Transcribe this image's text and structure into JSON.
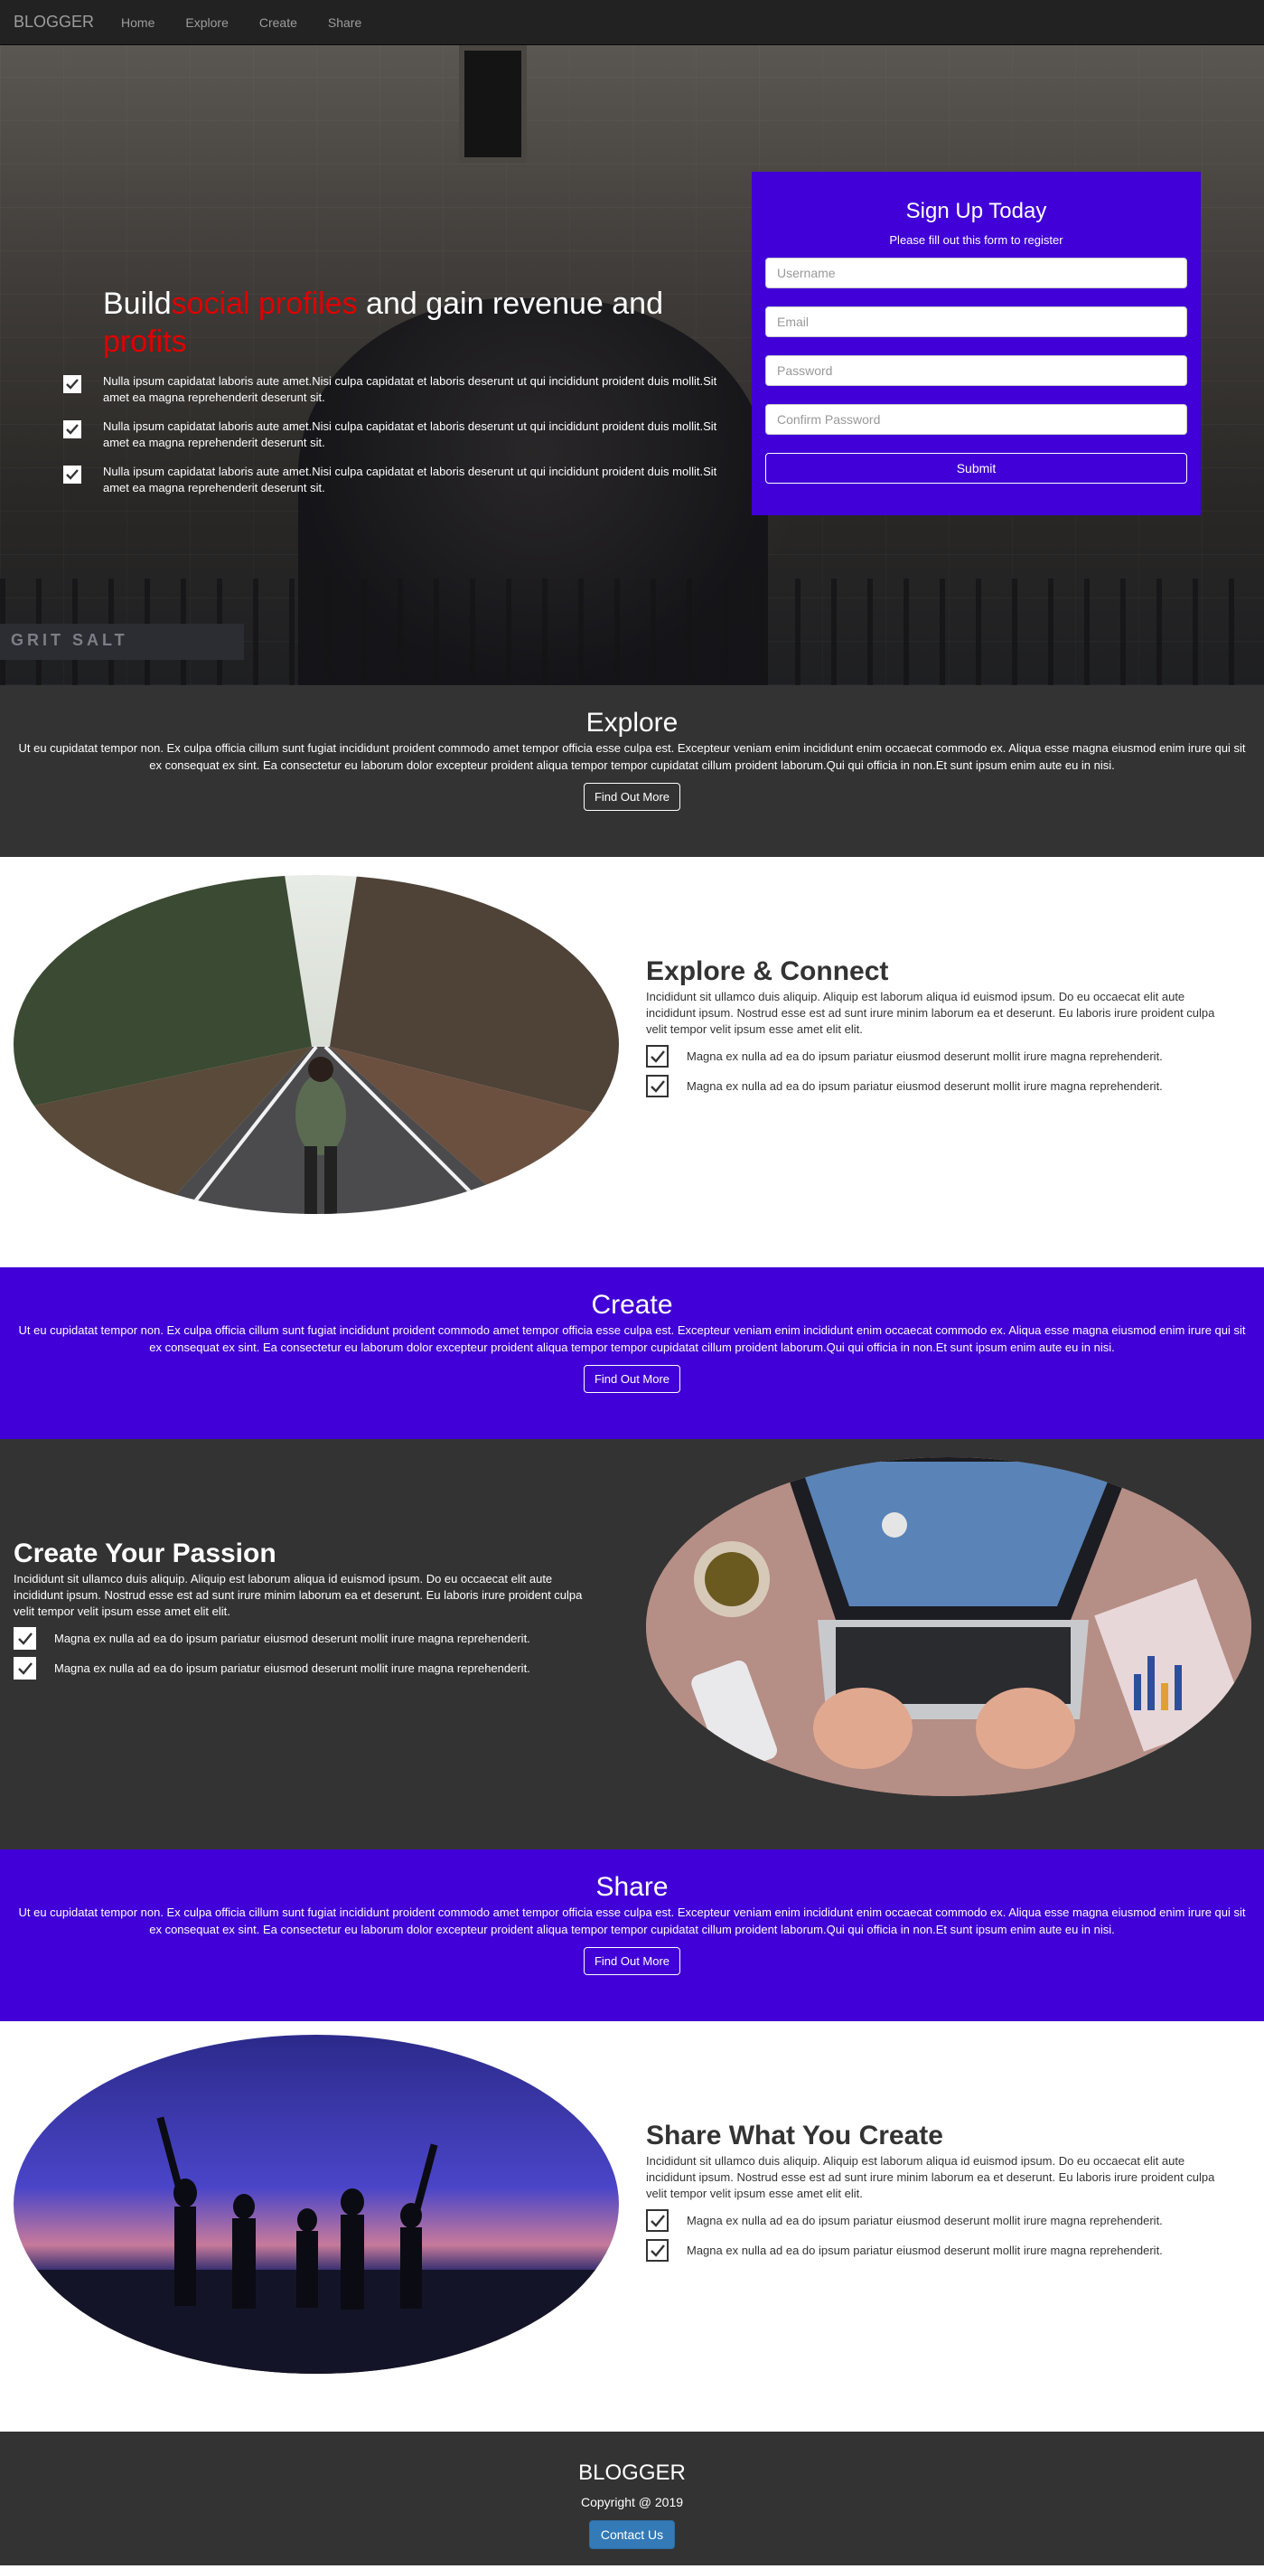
{
  "nav": {
    "brand": "BLOGGER",
    "items": [
      "Home",
      "Explore",
      "Create",
      "Share"
    ]
  },
  "hero": {
    "title_pre": "Build",
    "title_red1": "social profiles",
    "title_mid": " and gain revenue and ",
    "title_red2": "profits",
    "features": [
      "Nulla ipsum capidatat laboris aute amet.Nisi culpa capidatat et laboris deserunt ut qui incididunt proident duis mollit.Sit amet ea magna reprehenderit deserunt sit.",
      "Nulla ipsum capidatat laboris aute amet.Nisi culpa capidatat et laboris deserunt ut qui incididunt proident duis mollit.Sit amet ea magna reprehenderit deserunt sit.",
      "Nulla ipsum capidatat laboris aute amet.Nisi culpa capidatat et laboris deserunt ut qui incididunt proident duis mollit.Sit amet ea magna reprehenderit deserunt sit."
    ],
    "sign_text": "GRIT SALT"
  },
  "signup": {
    "title": "Sign Up Today",
    "subtitle": "Please fill out this form to register",
    "username_placeholder": "Username",
    "email_placeholder": "Email",
    "password_placeholder": "Password",
    "confirm_placeholder": "Confirm Password",
    "submit_label": "Submit"
  },
  "explore_band": {
    "title": "Explore",
    "text": "Ut eu cupidatat tempor non. Ex culpa officia cillum sunt fugiat incididunt proident commodo amet tempor officia esse culpa est. Excepteur veniam enim incididunt enim occaecat commodo ex. Aliqua esse magna eiusmod enim irure qui sit ex consequat ex sint. Ea consectetur eu laborum dolor excepteur proident aliqua tempor tempor cupidatat cillum proident laborum.Qui qui officia in non.Et sunt ipsum enim aute eu in nisi.",
    "button": "Find Out More"
  },
  "explore_feature": {
    "title": "Explore & Connect",
    "desc": "Incididunt sit ullamco duis aliquip. Aliquip est laborum aliqua id euismod ipsum. Do eu occaecat elit aute incididunt ipsum. Nostrud esse est ad sunt irure minim laborum ea et deserunt. Eu laboris irure proident culpa velit tempor velit ipsum esse amet elit elit.",
    "items": [
      "Magna ex nulla ad ea do ipsum pariatur eiusmod deserunt mollit irure magna reprehenderit.",
      "Magna ex nulla ad ea do ipsum pariatur eiusmod deserunt mollit irure magna reprehenderit."
    ]
  },
  "create_band": {
    "title": "Create",
    "text": "Ut eu cupidatat tempor non. Ex culpa officia cillum sunt fugiat incididunt proident commodo amet tempor officia esse culpa est. Excepteur veniam enim incididunt enim occaecat commodo ex. Aliqua esse magna eiusmod enim irure qui sit ex consequat ex sint. Ea consectetur eu laborum dolor excepteur proident aliqua tempor tempor cupidatat cillum proident laborum.Qui qui officia in non.Et sunt ipsum enim aute eu in nisi.",
    "button": "Find Out More"
  },
  "create_feature": {
    "title": "Create Your Passion",
    "desc": "Incididunt sit ullamco duis aliquip. Aliquip est laborum aliqua id euismod ipsum. Do eu occaecat elit aute incididunt ipsum. Nostrud esse est ad sunt irure minim laborum ea et deserunt. Eu laboris irure proident culpa velit tempor velit ipsum esse amet elit elit.",
    "items": [
      "Magna ex nulla ad ea do ipsum pariatur eiusmod deserunt mollit irure magna reprehenderit.",
      "Magna ex nulla ad ea do ipsum pariatur eiusmod deserunt mollit irure magna reprehenderit."
    ]
  },
  "share_band": {
    "title": "Share",
    "text": "Ut eu cupidatat tempor non. Ex culpa officia cillum sunt fugiat incididunt proident commodo amet tempor officia esse culpa est. Excepteur veniam enim incididunt enim occaecat commodo ex. Aliqua esse magna eiusmod enim irure qui sit ex consequat ex sint. Ea consectetur eu laborum dolor excepteur proident aliqua tempor tempor cupidatat cillum proident laborum.Qui qui officia in non.Et sunt ipsum enim aute eu in nisi.",
    "button": "Find Out More"
  },
  "share_feature": {
    "title": "Share What You Create",
    "desc": "Incididunt sit ullamco duis aliquip. Aliquip est laborum aliqua id euismod ipsum. Do eu occaecat elit aute incididunt ipsum. Nostrud esse est ad sunt irure minim laborum ea et deserunt. Eu laboris irure proident culpa velit tempor velit ipsum esse amet elit elit.",
    "items": [
      "Magna ex nulla ad ea do ipsum pariatur eiusmod deserunt mollit irure magna reprehenderit.",
      "Magna ex nulla ad ea do ipsum pariatur eiusmod deserunt mollit irure magna reprehenderit."
    ]
  },
  "footer": {
    "brand": "BLOGGER",
    "copyright": "Copyright @ 2019",
    "contact": "Contact Us"
  },
  "colors": {
    "accent_purple": "#4000d7",
    "dark": "#333333",
    "navbar": "#222222",
    "highlight_red": "#e00000",
    "contact_blue": "#337ab7"
  }
}
